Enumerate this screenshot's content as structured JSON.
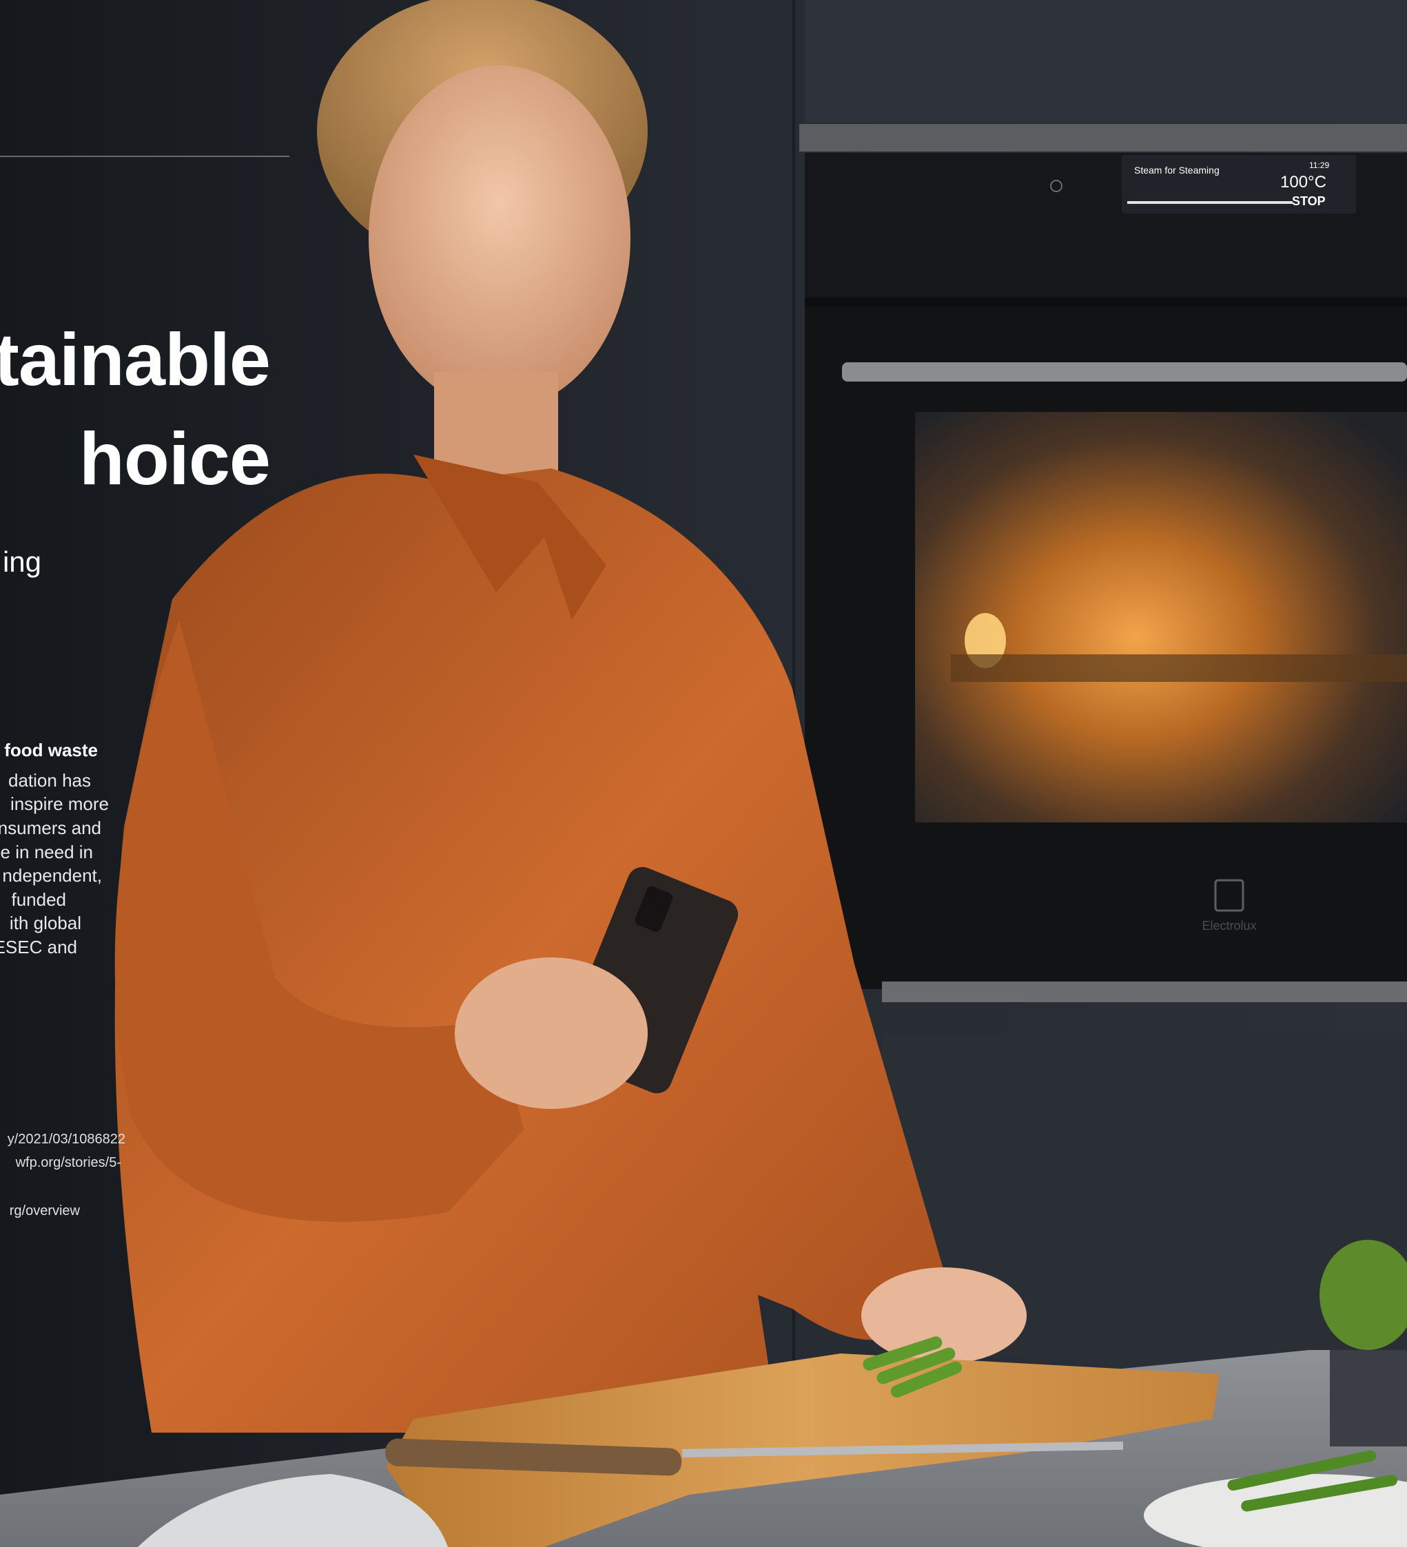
{
  "headline": {
    "line1": "tainable",
    "line2": "hoice"
  },
  "subheading": "ing",
  "body": {
    "heading": "food waste",
    "lines": [
      "dation has",
      " inspire more",
      "nsumers and",
      "e in need in",
      "ndependent,",
      " funded",
      "ith global",
      "ESEC and"
    ]
  },
  "references": [
    "y/2021/03/1086822",
    "wfp.org/stories/5-",
    "rg/overview"
  ],
  "oven_display": {
    "program": "Steam for Steaming",
    "time": "11:29",
    "temperature": "100°C",
    "stop_label": "STOP"
  },
  "brand": "Electrolux",
  "colors": {
    "background": "#1e2126",
    "shirt": "#c1622a",
    "oven_glow": "#e8902e",
    "cabinet": "#2a2e35"
  }
}
